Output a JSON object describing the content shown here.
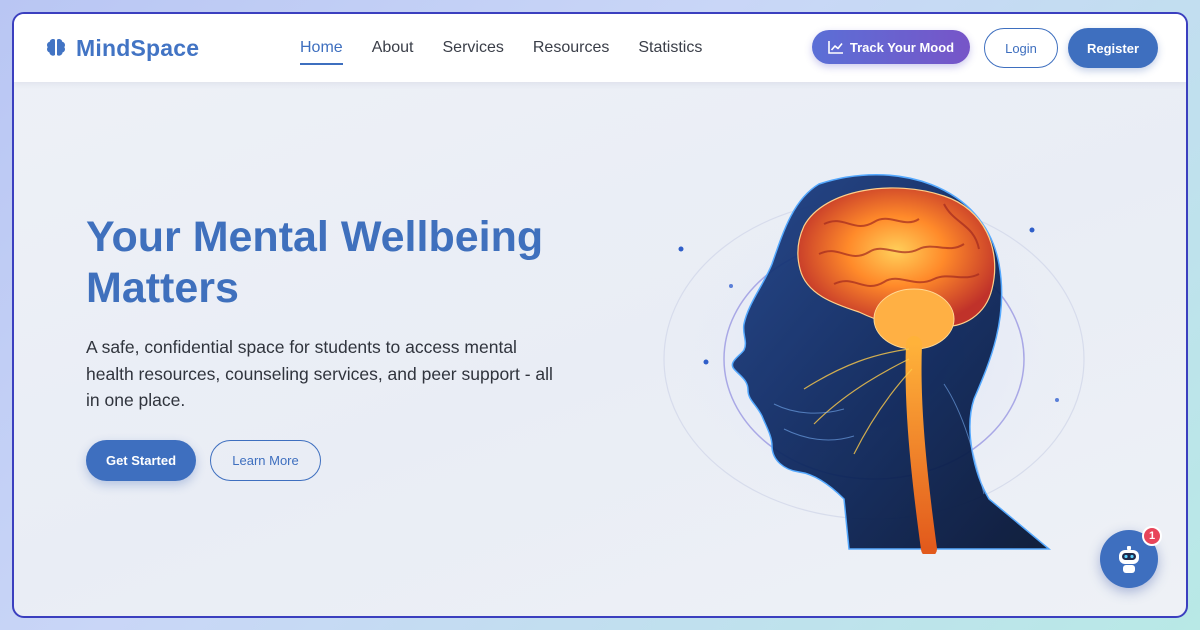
{
  "brand": {
    "name": "MindSpace",
    "icon": "brain-icon",
    "color": "#4274c4"
  },
  "nav": {
    "items": [
      {
        "label": "Home",
        "active": true
      },
      {
        "label": "About",
        "active": false
      },
      {
        "label": "Services",
        "active": false
      },
      {
        "label": "Resources",
        "active": false
      },
      {
        "label": "Statistics",
        "active": false
      }
    ],
    "mood_button": {
      "label": "Track Your Mood",
      "icon": "chart-line-icon"
    },
    "login_label": "Login",
    "register_label": "Register"
  },
  "hero": {
    "title_line1": "Your Mental Wellbeing",
    "title_line2": "Matters",
    "subtitle_lines": [
      "A safe, confidential space for students to access mental",
      "health resources, counseling services, and peer support - all",
      "in one place."
    ],
    "primary_cta": "Get Started",
    "secondary_cta": "Learn More",
    "image": "head-brain-illustration"
  },
  "chat": {
    "icon": "robot-icon",
    "badge_count": "1"
  },
  "colors": {
    "accent": "#3e6fbf",
    "mood_gradient_start": "#5b6fd6",
    "mood_gradient_end": "#7755c8",
    "badge": "#e8455a"
  }
}
